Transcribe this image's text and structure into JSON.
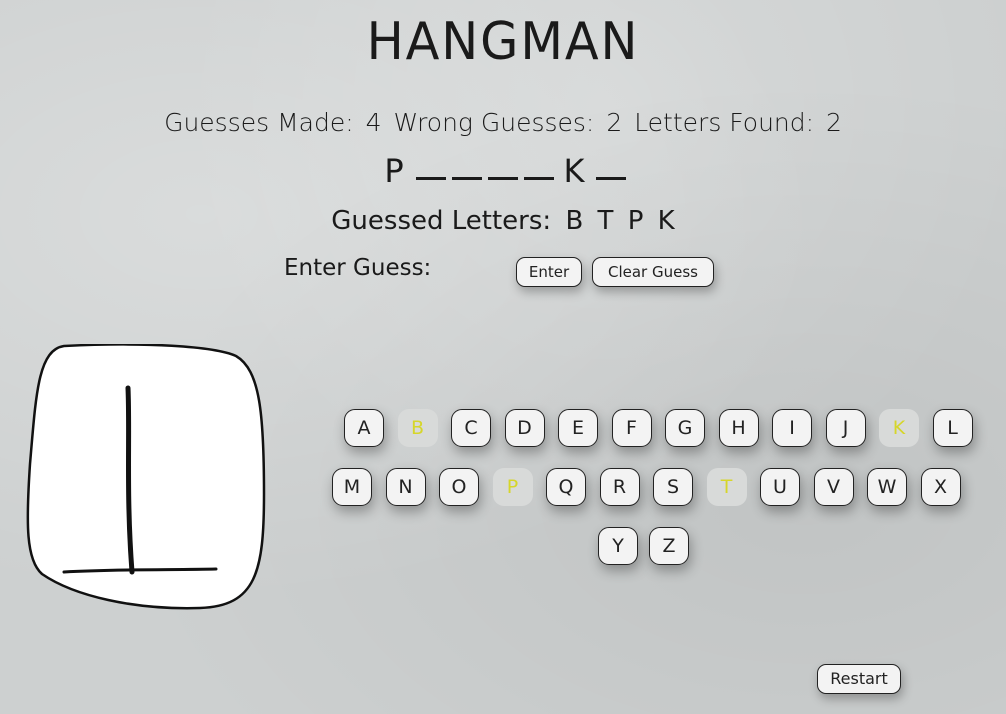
{
  "title": "HANGMAN",
  "stats": {
    "guesses_made_label": "Guesses Made:",
    "guesses_made": "4",
    "wrong_guesses_label": "Wrong Guesses:",
    "wrong_guesses": "2",
    "letters_found_label": "Letters Found:",
    "letters_found": "2"
  },
  "word": [
    "P",
    "",
    "",
    "",
    "",
    "K",
    ""
  ],
  "guessed": {
    "label": "Guessed Letters:",
    "letters": [
      "B",
      "T",
      "P",
      "K"
    ]
  },
  "entry": {
    "label": "Enter Guess:",
    "enter_label": "Enter",
    "clear_label": "Clear Guess"
  },
  "keyboard": {
    "rows": [
      [
        "A",
        "B",
        "C",
        "D",
        "E",
        "F",
        "G",
        "H",
        "I",
        "J",
        "K",
        "L"
      ],
      [
        "M",
        "N",
        "O",
        "P",
        "Q",
        "R",
        "S",
        "T",
        "U",
        "V",
        "W",
        "X"
      ],
      [
        "Y",
        "Z"
      ]
    ],
    "used": [
      "B",
      "K",
      "P",
      "T"
    ],
    "used_color": "#d6d62a"
  },
  "restart_label": "Restart"
}
